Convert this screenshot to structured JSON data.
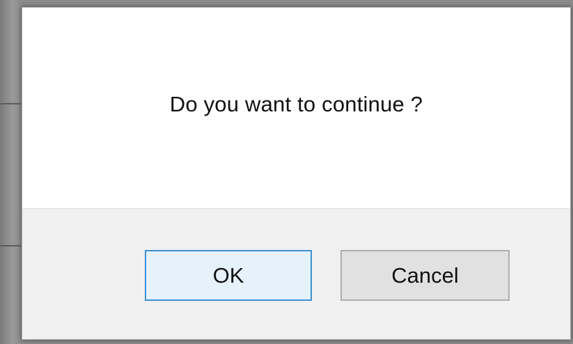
{
  "dialog": {
    "message": "Do you want to continue ?",
    "buttons": {
      "ok_label": "OK",
      "cancel_label": "Cancel"
    }
  }
}
